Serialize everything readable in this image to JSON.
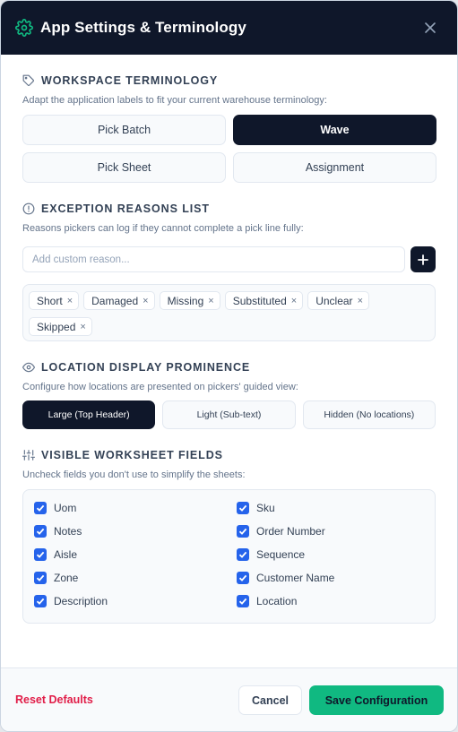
{
  "header": {
    "title": "App Settings & Terminology",
    "icon": "gear-icon",
    "accent": "#10b981"
  },
  "terminology": {
    "heading": "WORKSPACE TERMINOLOGY",
    "description": "Adapt the application labels to fit your current warehouse terminology:",
    "options": [
      "Pick Batch",
      "Wave",
      "Pick Sheet",
      "Assignment"
    ],
    "selected": "Wave"
  },
  "exceptions": {
    "heading": "EXCEPTION REASONS LIST",
    "description": "Reasons pickers can log if they cannot complete a pick line fully:",
    "placeholder": "Add custom reason...",
    "tags": [
      "Short",
      "Damaged",
      "Missing",
      "Substituted",
      "Unclear",
      "Skipped"
    ],
    "remove_glyph": "×"
  },
  "location": {
    "heading": "LOCATION DISPLAY PROMINENCE",
    "description": "Configure how locations are presented on pickers' guided view:",
    "options": [
      "Large (Top Header)",
      "Light (Sub-text)",
      "Hidden (No locations)"
    ],
    "selected": "Large (Top Header)"
  },
  "fields": {
    "heading": "VISIBLE WORKSHEET FIELDS",
    "description": "Uncheck fields you don't use to simplify the sheets:",
    "left": [
      "Uom",
      "Notes",
      "Aisle",
      "Zone",
      "Description"
    ],
    "right": [
      "Sku",
      "Order Number",
      "Sequence",
      "Customer Name",
      "Location"
    ],
    "checked_color": "#2563eb"
  },
  "footer": {
    "reset_label": "Reset Defaults",
    "cancel_label": "Cancel",
    "save_label": "Save Configuration"
  }
}
